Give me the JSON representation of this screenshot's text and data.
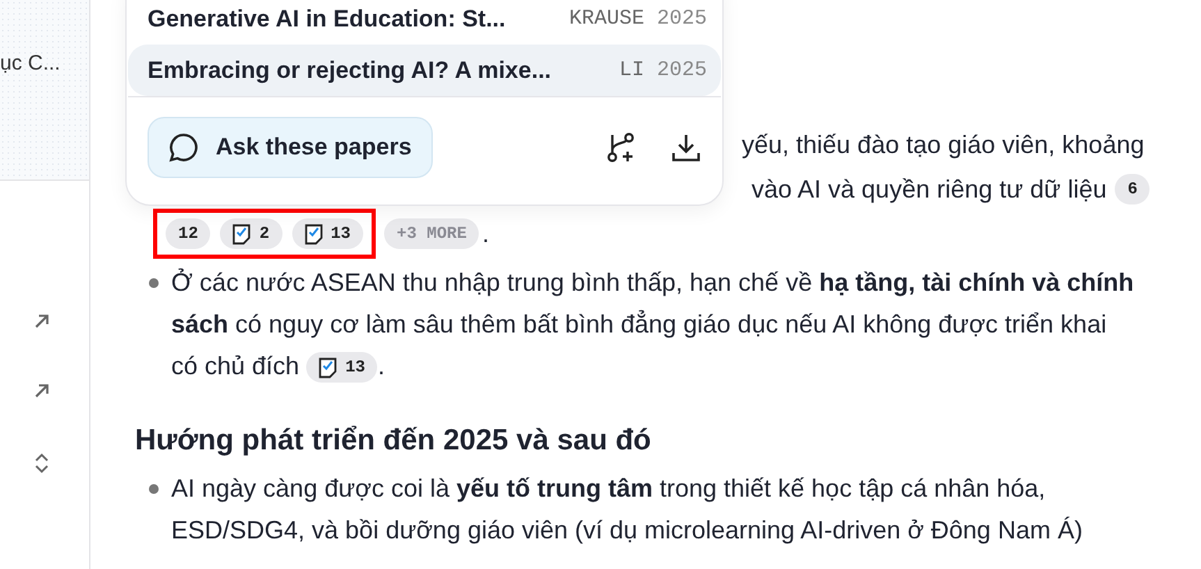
{
  "sidebar": {
    "truncated_title": "ục C..."
  },
  "papers_popover": {
    "papers": [
      {
        "title": "Generative AI in Education: St...",
        "author": "KRAUSE",
        "year": "2025",
        "selected": false
      },
      {
        "title": "Embracing or rejecting AI? A mixe...",
        "author": "LI",
        "year": "2025",
        "selected": true
      }
    ],
    "ask_button": "Ask these papers"
  },
  "answer": {
    "covered_lines": [
      {
        "text": "yếu, thiếu đào tạo giáo viên, khoảng"
      },
      {
        "text": "vào AI và quyền riêng tư dữ liệu",
        "citations": [
          {
            "kind": "number",
            "label": "6"
          }
        ]
      }
    ],
    "citation_line": {
      "group": {
        "highlighted": true,
        "citations": [
          {
            "kind": "number",
            "label": "12"
          },
          {
            "kind": "doc",
            "label": "2"
          },
          {
            "kind": "doc",
            "label": "13"
          }
        ]
      },
      "more": "+3 MORE",
      "end": "."
    },
    "bullets_1": [
      {
        "text": "Ở các nước ASEAN thu nhập trung bình thấp, hạn chế về **hạ tầng, tài chính và chính sách** có nguy cơ làm sâu thêm bất bình đẳng giáo dục nếu AI không được triển khai có chủ đích",
        "citations": [
          {
            "kind": "doc",
            "label": "13"
          }
        ],
        "end": "."
      }
    ],
    "heading": "Hướng phát triển đến 2025 và sau đó",
    "bullets_2": [
      {
        "text": "AI ngày càng được coi là **yếu tố trung tâm** trong thiết kế học tập cá nhân hóa, ESD/SDG4, và bồi dưỡng giáo viên (ví dụ microlearning AI-driven ở Đông Nam Á)"
      }
    ]
  }
}
